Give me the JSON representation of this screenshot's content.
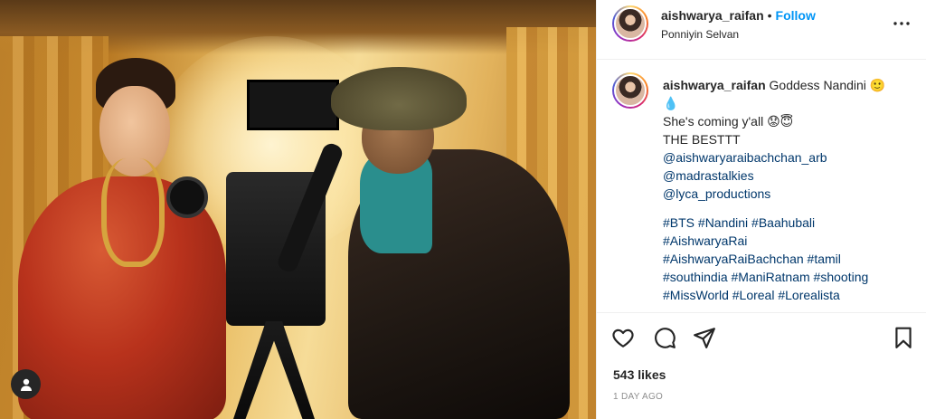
{
  "post": {
    "username": "aishwarya_raifan",
    "separator": "•",
    "follow_label": "Follow",
    "location": "Ponniyin Selvan",
    "more_icon": "more-horizontal-icon"
  },
  "caption": {
    "username": "aishwarya_raifan",
    "line1_text": "Goddess Nandini 🙂",
    "line2_text": "💧",
    "line3_text": "She's coming y'all 😟😇",
    "line4_text": "THE BESTTT",
    "mention1": "@aishwaryaraibachchan_arb",
    "mention2": "@madrastalkies",
    "mention3": "@lyca_productions",
    "hashtags_line1": "#BTS #Nandini #Baahubali",
    "hashtags_line2": "#AishwaryaRai",
    "hashtags_line3": "#AishwaryaRaiBachchan #tamil",
    "hashtags_line4": "#southindia #ManiRatnam #shooting",
    "hashtags_line5": "#MissWorld #Loreal #Lorealista"
  },
  "actions": {
    "like_icon": "heart-icon",
    "comment_icon": "comment-icon",
    "share_icon": "paper-plane-icon",
    "save_icon": "bookmark-icon"
  },
  "stats": {
    "likes": "543 likes",
    "time": "1 DAY AGO"
  },
  "colors": {
    "follow": "#0095f6",
    "link": "#00376b",
    "muted": "#8e8e8e",
    "text": "#262626"
  }
}
